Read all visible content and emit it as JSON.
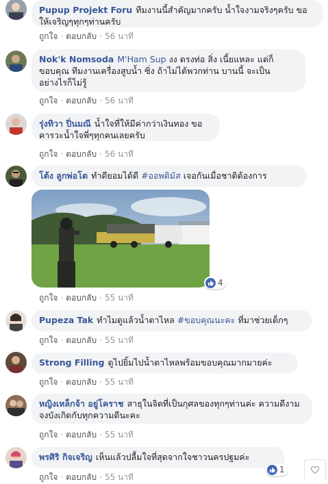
{
  "comments": [
    {
      "author": "Pupup Projekt Foru",
      "text": "ทีมงานนี้สำคัญมากครับ น้ำใจงามจริงๆครับ ขอให้เจริญๆทุกๆท่านครับ",
      "like": "ถูกใจ",
      "reply": "ตอบกลับ",
      "time": "56 นาที"
    },
    {
      "author": "Nok'k Nomsoda",
      "tag": "M'Ham Sup",
      "text": "งง ตรงท่อ สิ่ง เนี้ยแหละ แต่ก็ขอบคุณ ทีมงานเครื่องสูบน้ำ ซิ่ง ถ้าไม่ได้พวกท่าน บานนี้ จะเป็นอย่างไรก็ไม่รู้",
      "like": "ถูกใจ",
      "reply": "ตอบกลับ",
      "time": "56 นาที"
    },
    {
      "author": "รุ่งทิวา ปิ่นมณี",
      "text": "น้ำใจที่ให้มีค่ากว่าเงินทอง ขอคารวะน้ำใจพี่ๆทุกคนเลยครับ",
      "like": "ถูกใจ",
      "reply": "ตอบกลับ",
      "time": "56 นาที"
    },
    {
      "author": "โต้ง ลูกพ่อโต",
      "text_before": "ทำดียอมได้ดี",
      "hashtag": "#ออพติมัส",
      "text_after": "เจอกันเมื่อชาติต้องการ",
      "reaction_count": "4",
      "like": "ถูกใจ",
      "reply": "ตอบกลับ",
      "time": "55 นาที"
    },
    {
      "author": "Pupeza Tak",
      "text_before": "ทำไมดูแล้วน้ำตาไหล",
      "hashtag": "#ขอบคุณนะคะ",
      "text_after": "ที่มาช่วยเด็กๆ",
      "like": "ถูกใจ",
      "reply": "ตอบกลับ",
      "time": "55 นาที"
    },
    {
      "author": "Strong Filling",
      "text": "ดูไปยิ้มไปน้ำตาไหลพร้อมขอบคุณมากมายค่ะ",
      "like": "ถูกใจ",
      "reply": "ตอบกลับ",
      "time": "55 นาที"
    },
    {
      "author": "หญิงเหล็กจ้า อยู่โคราช",
      "text": "สาธุในจิตที่เป็นกุศลของทุกๆท่านค่ะ ความดีงามจงบังเกิดกับทุกความดีนะคะ",
      "like": "ถูกใจ",
      "reply": "ตอบกลับ",
      "time": "55 นาที"
    },
    {
      "author": "พรศิริ กิจเจริญ",
      "text": "เห็นแล้วปลื้มใจที่สุดจากใจชาวนครปฐมค่ะ",
      "reaction_count": "1",
      "like": "ถูกใจ",
      "reply": "ตอบกลับ",
      "time": "55 นาที"
    }
  ],
  "colors": {
    "link": "#385898",
    "bubble": "#f2f3f5",
    "like_blue": "#4267b2",
    "meta": "#90949c"
  }
}
